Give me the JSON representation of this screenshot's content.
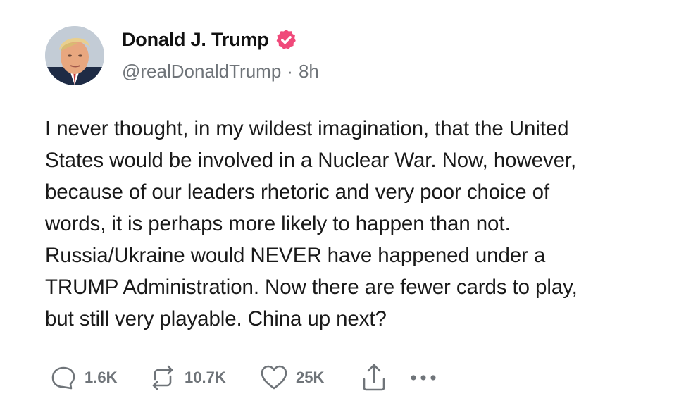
{
  "author": {
    "display_name": "Donald J. Trump",
    "handle": "@realDonaldTrump",
    "separator": "·",
    "time": "8h",
    "verified_color": "#f0497a"
  },
  "post": {
    "text": "I never thought, in my wildest imagination, that the United\nStates would be involved in a Nuclear War. Now, however,\nbecause of our leaders rhetoric and very poor choice of\nwords, it is perhaps more likely to happen than not.\nRussia/Ukraine would NEVER have happened under a\nTRUMP Administration. Now there are fewer cards to play,\nbut still very playable. China up next?"
  },
  "actions": {
    "replies": "1.6K",
    "reposts": "10.7K",
    "likes": "25K",
    "icons": [
      "reply-icon",
      "repost-icon",
      "heart-icon",
      "share-icon",
      "more-icon"
    ]
  },
  "colors": {
    "text": "#1a1a1a",
    "muted": "#6f7479",
    "background": "#ffffff"
  }
}
